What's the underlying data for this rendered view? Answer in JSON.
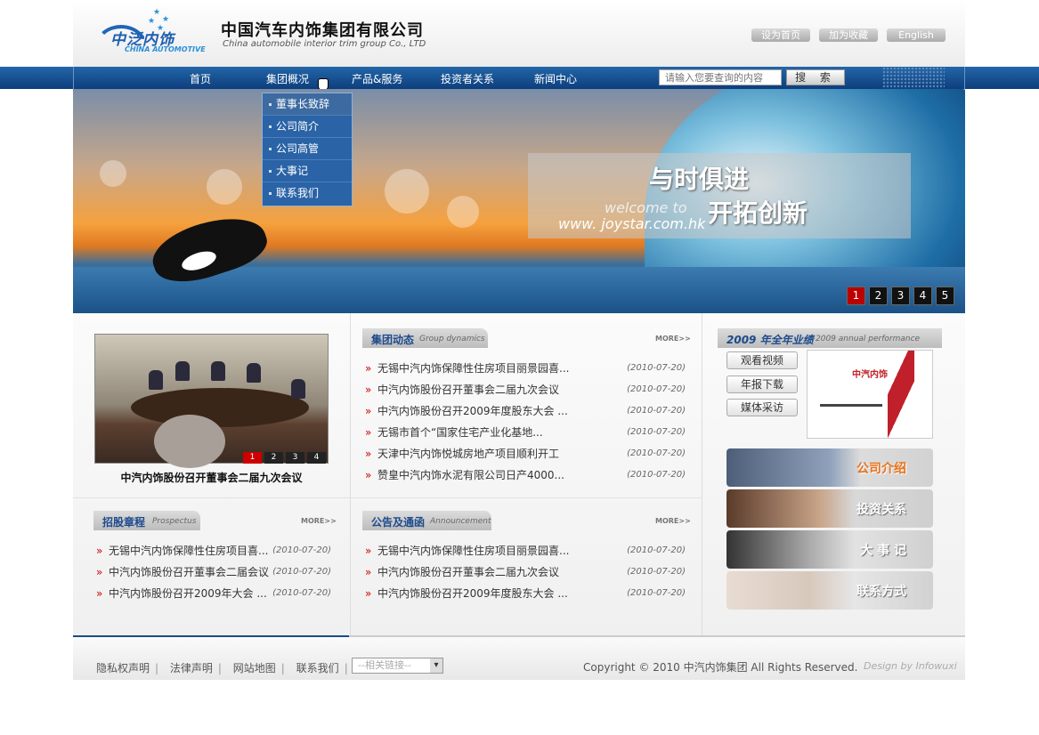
{
  "header": {
    "logo_cn": "中泛内饰",
    "logo_en": "CHINA AUTOMOTIVE",
    "company_cn": "中国汽车内饰集团有限公司",
    "company_en": "China automobile interior trim group Co., LTD",
    "top_links": [
      "设为首页",
      "加为收藏",
      "English"
    ]
  },
  "nav": {
    "items": [
      "首页",
      "集团概况",
      "产品&服务",
      "投资者关系",
      "新闻中心"
    ],
    "search_placeholder": "请输入您要查询的内容",
    "search_button": "搜 索",
    "dropdown": [
      "董事长致辞",
      "公司简介",
      "公司高管",
      "大事记",
      "联系我们"
    ]
  },
  "banner": {
    "slogan1": "与时俱进",
    "slogan2": "开拓创新",
    "welcome": "welcome to",
    "url": "www. joystar.com.hk",
    "pages": [
      "1",
      "2",
      "3",
      "4",
      "5"
    ],
    "active_page": "1"
  },
  "photo": {
    "caption": "中汽内饰股份召开董事会二届九次会议",
    "pages": [
      "1",
      "2",
      "3",
      "4"
    ]
  },
  "group_dynamics": {
    "title": "集团动态",
    "subtitle": "Group dynamics",
    "more": "MORE>>",
    "items": [
      {
        "text": "无锡中汽内饰保障性住房项目丽景园喜...",
        "date": "(2010-07-20)"
      },
      {
        "text": "中汽内饰股份召开董事会二届九次会议",
        "date": "(2010-07-20)"
      },
      {
        "text": "中汽内饰股份召开2009年度股东大会 ...",
        "date": "(2010-07-20)"
      },
      {
        "text": "无锡市首个“国家住宅产业化基地...",
        "date": "(2010-07-20)"
      },
      {
        "text": "天津中汽内饰悦城房地产项目顺利开工",
        "date": "(2010-07-20)"
      },
      {
        "text": "赞皇中汽内饰水泥有限公司日产4000...",
        "date": "(2010-07-20)"
      }
    ]
  },
  "performance": {
    "title": "2009 年全年业绩",
    "subtitle": "2009 annual performance",
    "buttons": [
      "观看视频",
      "年报下载",
      "媒体采访"
    ],
    "report_logo": "中汽内饰"
  },
  "prospectus": {
    "title": "招股章程",
    "subtitle": "Prospectus",
    "more": "MORE>>",
    "items": [
      {
        "text": "无锡中汽内饰保障性住房项目喜...",
        "date": "(2010-07-20)"
      },
      {
        "text": "中汽内饰股份召开董事会二届会议",
        "date": "(2010-07-20)"
      },
      {
        "text": "中汽内饰股份召开2009年大会 ...",
        "date": "(2010-07-20)"
      }
    ]
  },
  "announcement": {
    "title": "公告及通函",
    "subtitle": "Announcement",
    "more": "MORE>>",
    "items": [
      {
        "text": "无锡中汽内饰保障性住房项目丽景园喜...",
        "date": "(2010-07-20)"
      },
      {
        "text": "中汽内饰股份召开董事会二届九次会议",
        "date": "(2010-07-20)"
      },
      {
        "text": "中汽内饰股份召开2009年度股东大会 ...",
        "date": "(2010-07-20)"
      }
    ]
  },
  "tiles": [
    "公司介绍",
    "投资关系",
    "大 事 记",
    "联系方式"
  ],
  "footer": {
    "links": [
      "隐私权声明",
      "法律声明",
      "网站地图",
      "联系我们"
    ],
    "select": "--相关链接--",
    "copyright": "Copyright © 2010  中汽内饰集团  All Rights Reserved.",
    "design": "Design by Infowuxi"
  }
}
